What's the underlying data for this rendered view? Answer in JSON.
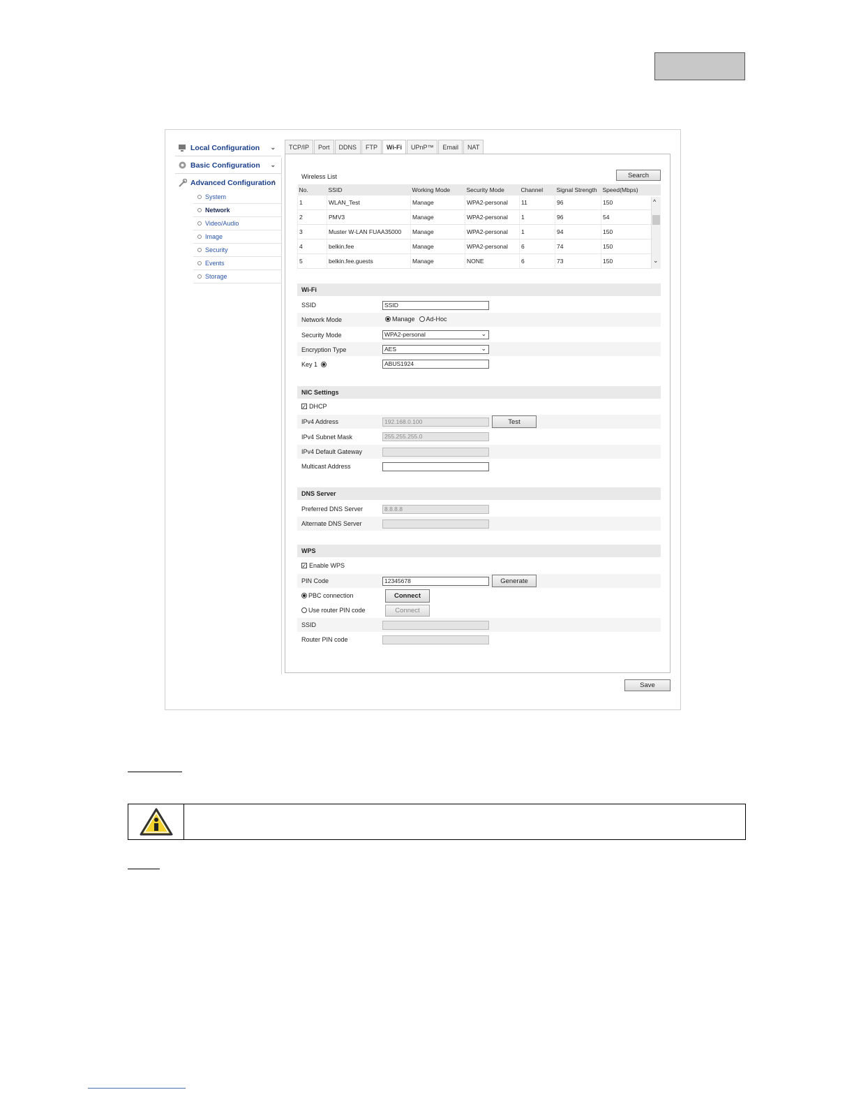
{
  "sidebar": {
    "local_config": "Local Configuration",
    "basic_config": "Basic Configuration",
    "advanced_config": "Advanced Configuration",
    "items": [
      "System",
      "Network",
      "Video/Audio",
      "Image",
      "Security",
      "Events",
      "Storage"
    ]
  },
  "tabs": [
    "TCP/IP",
    "Port",
    "DDNS",
    "FTP",
    "Wi-Fi",
    "UPnP™",
    "Email",
    "NAT"
  ],
  "wireless_list": {
    "title": "Wireless List",
    "search_label": "Search",
    "columns": [
      "No.",
      "SSID",
      "Working Mode",
      "Security Mode",
      "Channel",
      "Signal Strength",
      "Speed(Mbps)"
    ],
    "rows": [
      [
        "1",
        "WLAN_Test",
        "Manage",
        "WPA2-personal",
        "11",
        "96",
        "150"
      ],
      [
        "2",
        "PMV3",
        "Manage",
        "WPA2-personal",
        "1",
        "96",
        "54"
      ],
      [
        "3",
        "Muster W-LAN FUAA35000",
        "Manage",
        "WPA2-personal",
        "1",
        "94",
        "150"
      ],
      [
        "4",
        "belkin.fee",
        "Manage",
        "WPA2-personal",
        "6",
        "74",
        "150"
      ],
      [
        "5",
        "belkin.fee.guests",
        "Manage",
        "NONE",
        "6",
        "73",
        "150"
      ]
    ]
  },
  "wifi": {
    "title": "Wi-Fi",
    "ssid_label": "SSID",
    "ssid_value": "SSID",
    "network_mode_label": "Network Mode",
    "mode_manage": "Manage",
    "mode_adhoc": "Ad-Hoc",
    "security_mode_label": "Security Mode",
    "security_mode_value": "WPA2-personal",
    "encryption_label": "Encryption Type",
    "encryption_value": "AES",
    "key_label": "Key 1",
    "key_value": "ABUS1924"
  },
  "nic": {
    "title": "NIC Settings",
    "dhcp_label": "DHCP",
    "ipv4_label": "IPv4 Address",
    "ipv4_value": "192.168.0.100",
    "test_label": "Test",
    "mask_label": "IPv4 Subnet Mask",
    "mask_value": "255.255.255.0",
    "gateway_label": "IPv4 Default Gateway",
    "gateway_value": "",
    "multicast_label": "Multicast Address",
    "multicast_value": ""
  },
  "dns": {
    "title": "DNS Server",
    "preferred_label": "Preferred DNS Server",
    "preferred_value": "8.8.8.8",
    "alternate_label": "Alternate DNS Server",
    "alternate_value": ""
  },
  "wps": {
    "title": "WPS",
    "enable_label": "Enable WPS",
    "pin_label": "PIN Code",
    "pin_value": "12345678",
    "generate_label": "Generate",
    "pbc_label": "PBC connection",
    "router_pin_label": "Use router PIN code",
    "connect_label": "Connect",
    "ssid_label": "SSID",
    "router_pin_code_label": "Router PIN code"
  },
  "save_label": "Save"
}
